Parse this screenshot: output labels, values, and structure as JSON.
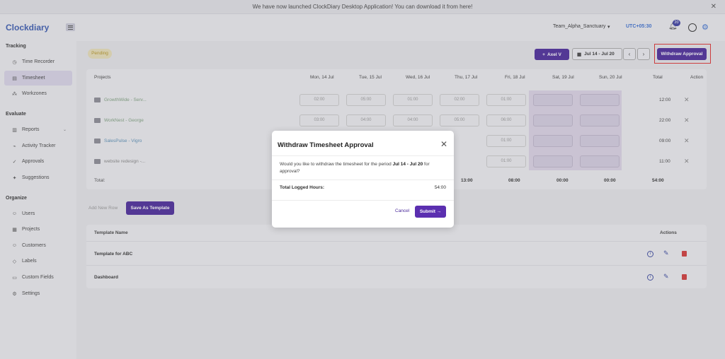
{
  "banner": {
    "text": "We have now launched ClockDiary Desktop Application! You can download it from here!",
    "close": "✕"
  },
  "header": {
    "logo": "Clockdiary",
    "team": "Team_Alpha_Sanctuary",
    "timezone": "UTC+05:30",
    "notifications": "20"
  },
  "sidebar": {
    "sections": [
      "Tracking",
      "Evaluate",
      "Organize"
    ],
    "items": [
      {
        "label": "Time Recorder",
        "icon": "clock-icon"
      },
      {
        "label": "Timesheet",
        "icon": "timesheet-icon"
      },
      {
        "label": "Workzones",
        "icon": "workzones-icon"
      },
      {
        "label": "Reports",
        "icon": "reports-icon"
      },
      {
        "label": "Activity Tracker",
        "icon": "activity-icon"
      },
      {
        "label": "Approvals",
        "icon": "approvals-icon"
      },
      {
        "label": "Suggestions",
        "icon": "suggestions-icon"
      },
      {
        "label": "Users",
        "icon": "users-icon"
      },
      {
        "label": "Projects",
        "icon": "projects-icon"
      },
      {
        "label": "Customers",
        "icon": "customers-icon"
      },
      {
        "label": "Labels",
        "icon": "labels-icon"
      },
      {
        "label": "Custom Fields",
        "icon": "custom-fields-icon"
      },
      {
        "label": "Settings",
        "icon": "settings-icon"
      }
    ]
  },
  "toolbar": {
    "status": "Pending",
    "user_button": "Axel V",
    "date_range": "Jul 14 - Jul 20",
    "prev": "‹",
    "next": "›",
    "withdraw_button": "Withdraw Approval"
  },
  "timesheet": {
    "headers": [
      "Projects",
      "Mon, 14 Jul",
      "Tue, 15 Jul",
      "Wed, 16 Jul",
      "Thu, 17 Jul",
      "Fri, 18 Jul",
      "Sat, 19 Jul",
      "Sun, 20 Jul",
      "Total",
      "Action"
    ],
    "rows": [
      {
        "project": "GrowthWide - Serv...",
        "cells": [
          "02:00",
          "05:00",
          "01:00",
          "02:00",
          "01:00",
          "",
          ""
        ],
        "total": "12:00"
      },
      {
        "project": "WorkNest - George",
        "cells": [
          "03:00",
          "04:00",
          "04:00",
          "05:00",
          "06:00",
          "",
          ""
        ],
        "total": "22:00"
      },
      {
        "project": "SalesPulse - Vigro",
        "cells": [
          "",
          "",
          "",
          "",
          "01:00",
          "",
          ""
        ],
        "total": "09:00"
      },
      {
        "project": "website redesign -...",
        "cells": [
          "",
          "",
          "",
          "",
          "01:00",
          "",
          ""
        ],
        "total": "11:00"
      }
    ],
    "total_label": "Total:",
    "totals": [
      "",
      "",
      "",
      "13:00",
      "08:00",
      "00:00",
      "00:00"
    ],
    "grand_total": "54:00",
    "add_row": "Add New Row",
    "save_template": "Save As Template"
  },
  "templates": {
    "header_name": "Template Name",
    "header_actions": "Actions",
    "items": [
      "Template for ABC",
      "Dashboard"
    ]
  },
  "modal": {
    "title": "Withdraw Timesheet Approval",
    "body_prefix": "Would you like to withdraw the timesheet for the period ",
    "body_period": "Jul 14 - Jul 20",
    "body_suffix": " for approval?",
    "hours_label": "Total Logged Hours:",
    "hours_value": "54:00",
    "cancel": "Cancel",
    "submit": "Submit →"
  },
  "colors": {
    "accent": "#4b2a9a",
    "link": "#3b6fd0",
    "danger": "#d23a3a"
  }
}
